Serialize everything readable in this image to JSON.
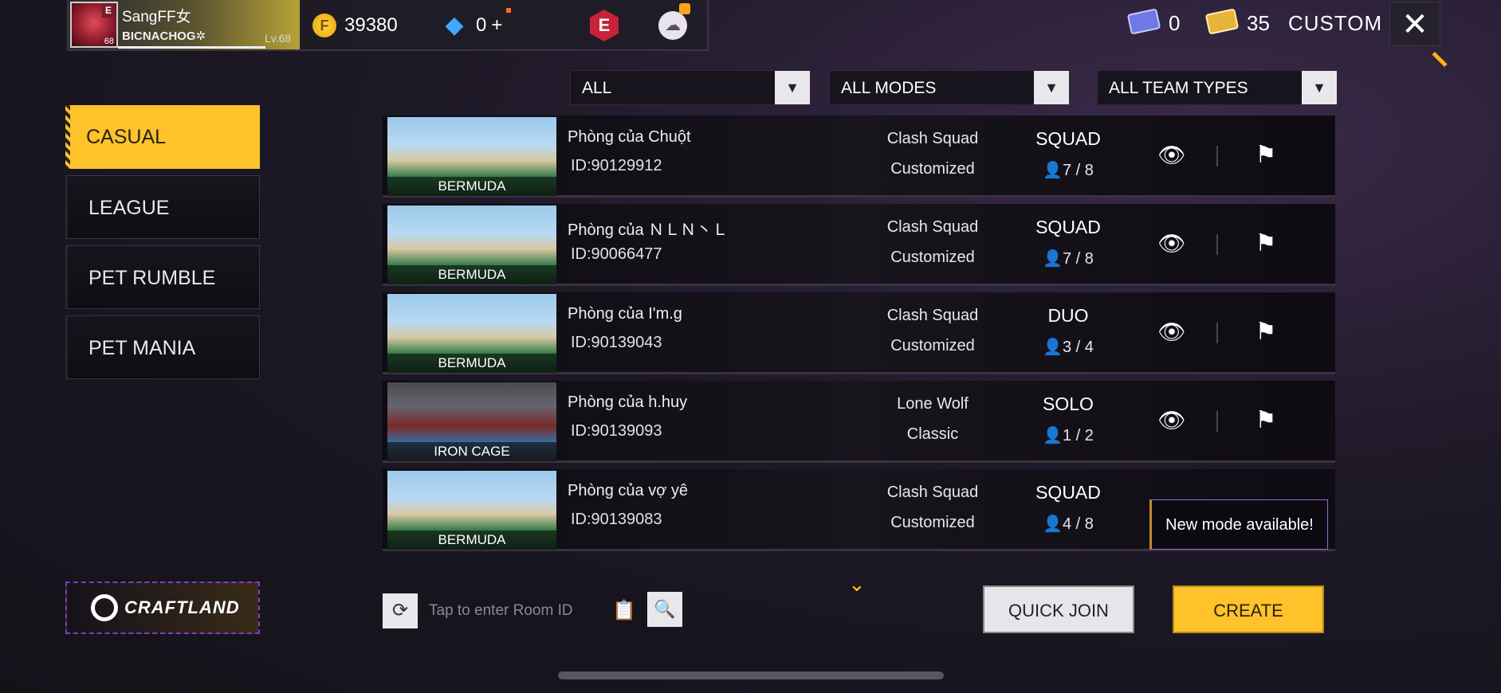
{
  "profile": {
    "name": "SangFF女",
    "guild": "BICNACHOG✲",
    "level": "Lv.68",
    "avatar_level": "68",
    "avatar_rank": "E"
  },
  "currency": {
    "gold": "39380",
    "diamonds": "0",
    "diamonds_plus": "+"
  },
  "header": {
    "e_badge": "E",
    "ticket_blue": "0",
    "ticket_gold": "35",
    "title": "CUSTOM",
    "close": "✕"
  },
  "sidebar": {
    "items": [
      {
        "label": "CASUAL"
      },
      {
        "label": "LEAGUE"
      },
      {
        "label": "PET RUMBLE"
      },
      {
        "label": "PET MANIA"
      }
    ],
    "craftland": "CRAFTLAND"
  },
  "filters": {
    "map": "ALL",
    "mode": "ALL MODES",
    "team": "ALL TEAM TYPES"
  },
  "rooms": [
    {
      "map": "BERMUDA",
      "name": "Phòng của Chuột",
      "id": "ID:90129912",
      "mode": "Clash Squad",
      "submode": "Customized",
      "team": "SQUAD",
      "count": "7 / 8"
    },
    {
      "map": "BERMUDA",
      "name": "Phòng của ＮＬＮ丶Ｌ",
      "id": "ID:90066477",
      "mode": "Clash Squad",
      "submode": "Customized",
      "team": "SQUAD",
      "count": "7 / 8"
    },
    {
      "map": "BERMUDA",
      "name": "Phòng của I'm.g",
      "id": "ID:90139043",
      "mode": "Clash Squad",
      "submode": "Customized",
      "team": "DUO",
      "count": "3 / 4"
    },
    {
      "map": "IRON CAGE",
      "name": "Phòng của h.huy",
      "id": "ID:90139093",
      "mode": "Lone Wolf",
      "submode": "Classic",
      "team": "SOLO",
      "count": "1 / 2"
    },
    {
      "map": "BERMUDA",
      "name": "Phòng của vợ yê",
      "id": "ID:90139083",
      "mode": "Clash Squad",
      "submode": "Customized",
      "team": "SQUAD",
      "count": "4 / 8"
    }
  ],
  "tooltip": "New mode available!",
  "search": {
    "placeholder": "Tap to enter Room ID"
  },
  "actions": {
    "quick_join": "QUICK JOIN",
    "create": "CREATE"
  }
}
